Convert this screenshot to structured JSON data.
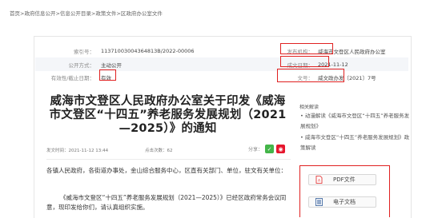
{
  "breadcrumb": [
    "首页",
    "政府信息公开",
    "信息公开目录",
    "政策文件",
    "区政府办公室文件"
  ],
  "breadcrumb_sep": ">",
  "meta": {
    "index_no_label": "索引号：",
    "index_no": "11371003004364813B/2022-00006",
    "publisher_label": "发布机构：",
    "publisher": "威海市文登区人民政府办公室",
    "disclosure_label": "公开方式：",
    "disclosure": "主动公开",
    "date_label": "成文日期：",
    "date": "2021-11-12",
    "validity_label": "有效性/截止日期：",
    "validity": "有效",
    "docno_label": "文号：",
    "docno": "威文政办发〔2021〕7号"
  },
  "article": {
    "title": "威海市文登区人民政府办公室关于印发《威海市文登区“十四五”养老服务发展规划（2021—2025）》的通知",
    "publish_time": "发文时间：2021-11-12 13:44",
    "clicks": "点击次数：62",
    "share_label": "分享：",
    "para1": "各镇人民政府，各街道办事处，金山综合服务中心，区直有关部门、单位，驻文有关单位：",
    "para2": "《威海市文登区“十四五”养老服务发展规划（2021—2025）》已经区政府常务会议同意，现印发给你们，请认真组织实施。"
  },
  "sidebar": {
    "title": "相关解读",
    "items": [
      "• 动漫解读《威海市文登区“十四五”养老服务发展规划》",
      "• 威海市文登区“十四五”养老服务发展规划》政策解读"
    ]
  },
  "downloads": {
    "pdf_label": "PDF文件",
    "doc_label": "电子文档"
  },
  "colors": {
    "highlight": "#e02020",
    "wechat": "#44b549",
    "weibo": "#e6162d"
  }
}
